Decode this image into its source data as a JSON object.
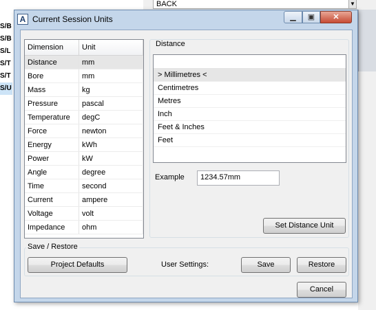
{
  "background": {
    "left_rows": [
      "S/B",
      "S/B",
      "S/L",
      "S/T",
      "S/T",
      "S/U"
    ],
    "back_field": "BACK"
  },
  "window": {
    "title": "Current Session Units",
    "app_icon_letter": "A"
  },
  "dimension_table": {
    "headers": [
      "Dimension",
      "Unit"
    ],
    "rows": [
      {
        "dimension": "Distance",
        "unit": "mm",
        "selected": true
      },
      {
        "dimension": "Bore",
        "unit": "mm"
      },
      {
        "dimension": "Mass",
        "unit": "kg"
      },
      {
        "dimension": "Pressure",
        "unit": "pascal"
      },
      {
        "dimension": "Temperature",
        "unit": "degC"
      },
      {
        "dimension": "Force",
        "unit": "newton"
      },
      {
        "dimension": "Energy",
        "unit": "kWh"
      },
      {
        "dimension": "Power",
        "unit": "kW"
      },
      {
        "dimension": "Angle",
        "unit": "degree"
      },
      {
        "dimension": "Time",
        "unit": "second"
      },
      {
        "dimension": "Current",
        "unit": "ampere"
      },
      {
        "dimension": "Voltage",
        "unit": "volt"
      },
      {
        "dimension": "Impedance",
        "unit": "ohm"
      }
    ]
  },
  "distance_panel": {
    "group_label": "Distance",
    "units": [
      {
        "label": "> Millimetres <",
        "selected": true
      },
      {
        "label": "Centimetres"
      },
      {
        "label": "Metres"
      },
      {
        "label": "Inch"
      },
      {
        "label": "Feet & Inches"
      },
      {
        "label": "Feet"
      }
    ],
    "example_label": "Example",
    "example_value": "1234.57mm",
    "set_button": "Set Distance Unit"
  },
  "save_restore": {
    "group_label": "Save / Restore",
    "project_defaults_button": "Project Defaults",
    "user_settings_label": "User Settings:",
    "save_button": "Save",
    "restore_button": "Restore"
  },
  "cancel_button": "Cancel"
}
